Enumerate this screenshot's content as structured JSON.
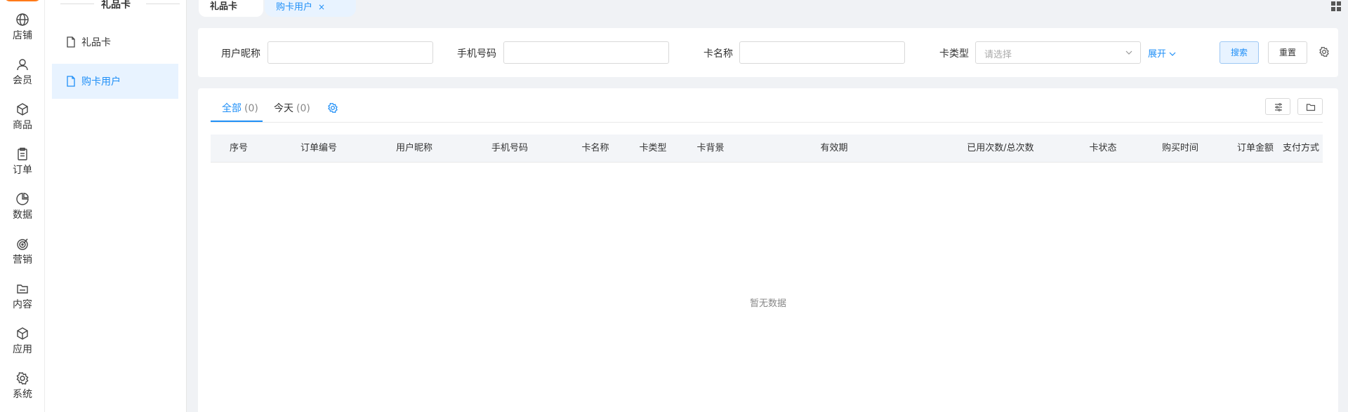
{
  "nav": {
    "items": [
      {
        "label": "店铺",
        "icon": "store-globe-icon"
      },
      {
        "label": "会员",
        "icon": "user-icon"
      },
      {
        "label": "商品",
        "icon": "box-icon"
      },
      {
        "label": "订单",
        "icon": "clipboard-icon"
      },
      {
        "label": "数据",
        "icon": "pie-chart-icon"
      },
      {
        "label": "营销",
        "icon": "target-icon"
      },
      {
        "label": "内容",
        "icon": "folder-icon"
      },
      {
        "label": "应用",
        "icon": "cube-icon"
      },
      {
        "label": "系统",
        "icon": "gear-icon"
      }
    ]
  },
  "submenu": {
    "title": "礼品卡",
    "items": [
      {
        "label": "礼品卡",
        "active": false
      },
      {
        "label": "购卡用户",
        "active": true
      }
    ]
  },
  "tabs": [
    {
      "label": "礼品卡"
    },
    {
      "label": "购卡用户",
      "close": "×"
    }
  ],
  "search": {
    "nickname_label": "用户昵称",
    "phone_label": "手机号码",
    "card_name_label": "卡名称",
    "card_type_label": "卡类型",
    "card_type_placeholder": "请选择",
    "expand_label": "展开",
    "search_button": "搜索",
    "reset_button": "重置"
  },
  "table": {
    "tabs": [
      {
        "label": "全部",
        "count": "(0)",
        "active": true
      },
      {
        "label": "今天",
        "count": "(0)",
        "active": false
      }
    ],
    "columns": [
      "序号",
      "订单编号",
      "用户昵称",
      "手机号码",
      "卡名称",
      "卡类型",
      "卡背景",
      "有效期",
      "已用次数/总次数",
      "卡状态",
      "购买时间",
      "订单金额",
      "支付方式"
    ],
    "empty_text": "暂无数据"
  },
  "colors": {
    "accent": "#1f8ff7",
    "accent_bg": "#e8f3ff",
    "brand_orange": "#ff7a18"
  }
}
